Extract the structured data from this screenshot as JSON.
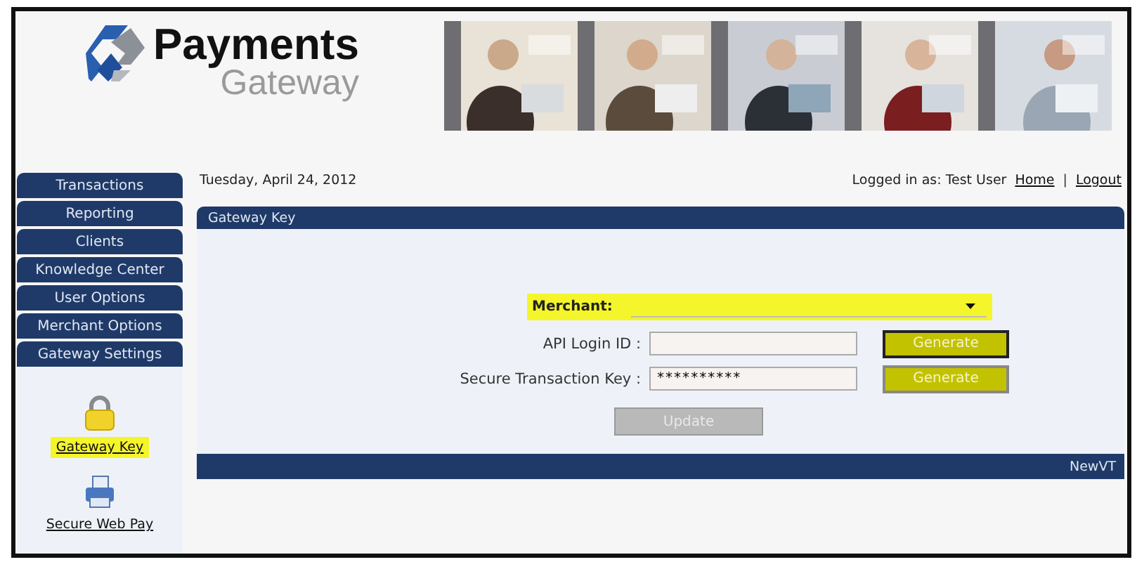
{
  "header": {
    "logo_title": "Payments",
    "logo_subtitle": "Gateway"
  },
  "sidebar": {
    "tabs": [
      "Transactions",
      "Reporting",
      "Clients",
      "Knowledge Center",
      "User Options",
      "Merchant Options",
      "Gateway Settings"
    ],
    "links": [
      {
        "kind": "lock",
        "label": "Gateway Key",
        "highlighted": true
      },
      {
        "kind": "printer",
        "label": "Secure Web Pay",
        "highlighted": false
      }
    ]
  },
  "topbar": {
    "date": "Tuesday, April 24, 2012",
    "logged_in": "Logged in as: Test User",
    "links": [
      "Home",
      "Logout"
    ],
    "separator": "|"
  },
  "panel": {
    "title": "Gateway Key",
    "footer": "NewVT",
    "merchant": {
      "label": "Merchant:",
      "highlighted": true
    },
    "fields": [
      {
        "label": "API Login ID :",
        "button": "Generate",
        "focused": true
      },
      {
        "label": "Secure Transaction Key :",
        "value": "**********",
        "button": "Generate",
        "focused": false
      }
    ],
    "update": {
      "label": "Update",
      "disabled": true
    }
  }
}
